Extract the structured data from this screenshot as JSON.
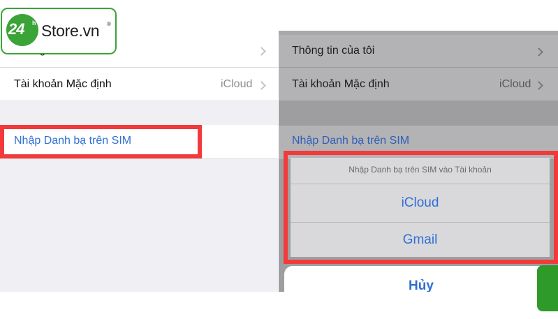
{
  "logo": {
    "number": "24",
    "superscript": "h",
    "brand": "Store.vn",
    "registered": "®"
  },
  "left": {
    "row1_label": "Thông tin của tôi",
    "row2_label": "Tài khoản Mặc định",
    "row2_value": "iCloud",
    "import_sim": "Nhập Danh bạ trên SIM"
  },
  "right": {
    "row1_label": "Thông tin của tôi",
    "row2_label": "Tài khoản Mặc định",
    "row2_value": "iCloud",
    "import_sim": "Nhập Danh bạ trên SIM",
    "sheet": {
      "title": "Nhập Danh bạ trên SIM vào Tài khoản",
      "options": [
        "iCloud",
        "Gmail"
      ],
      "cancel": "Hủy"
    }
  },
  "colors": {
    "highlight": "#f23a3a",
    "link": "#2f6fd6",
    "brand_green": "#3aa437"
  }
}
